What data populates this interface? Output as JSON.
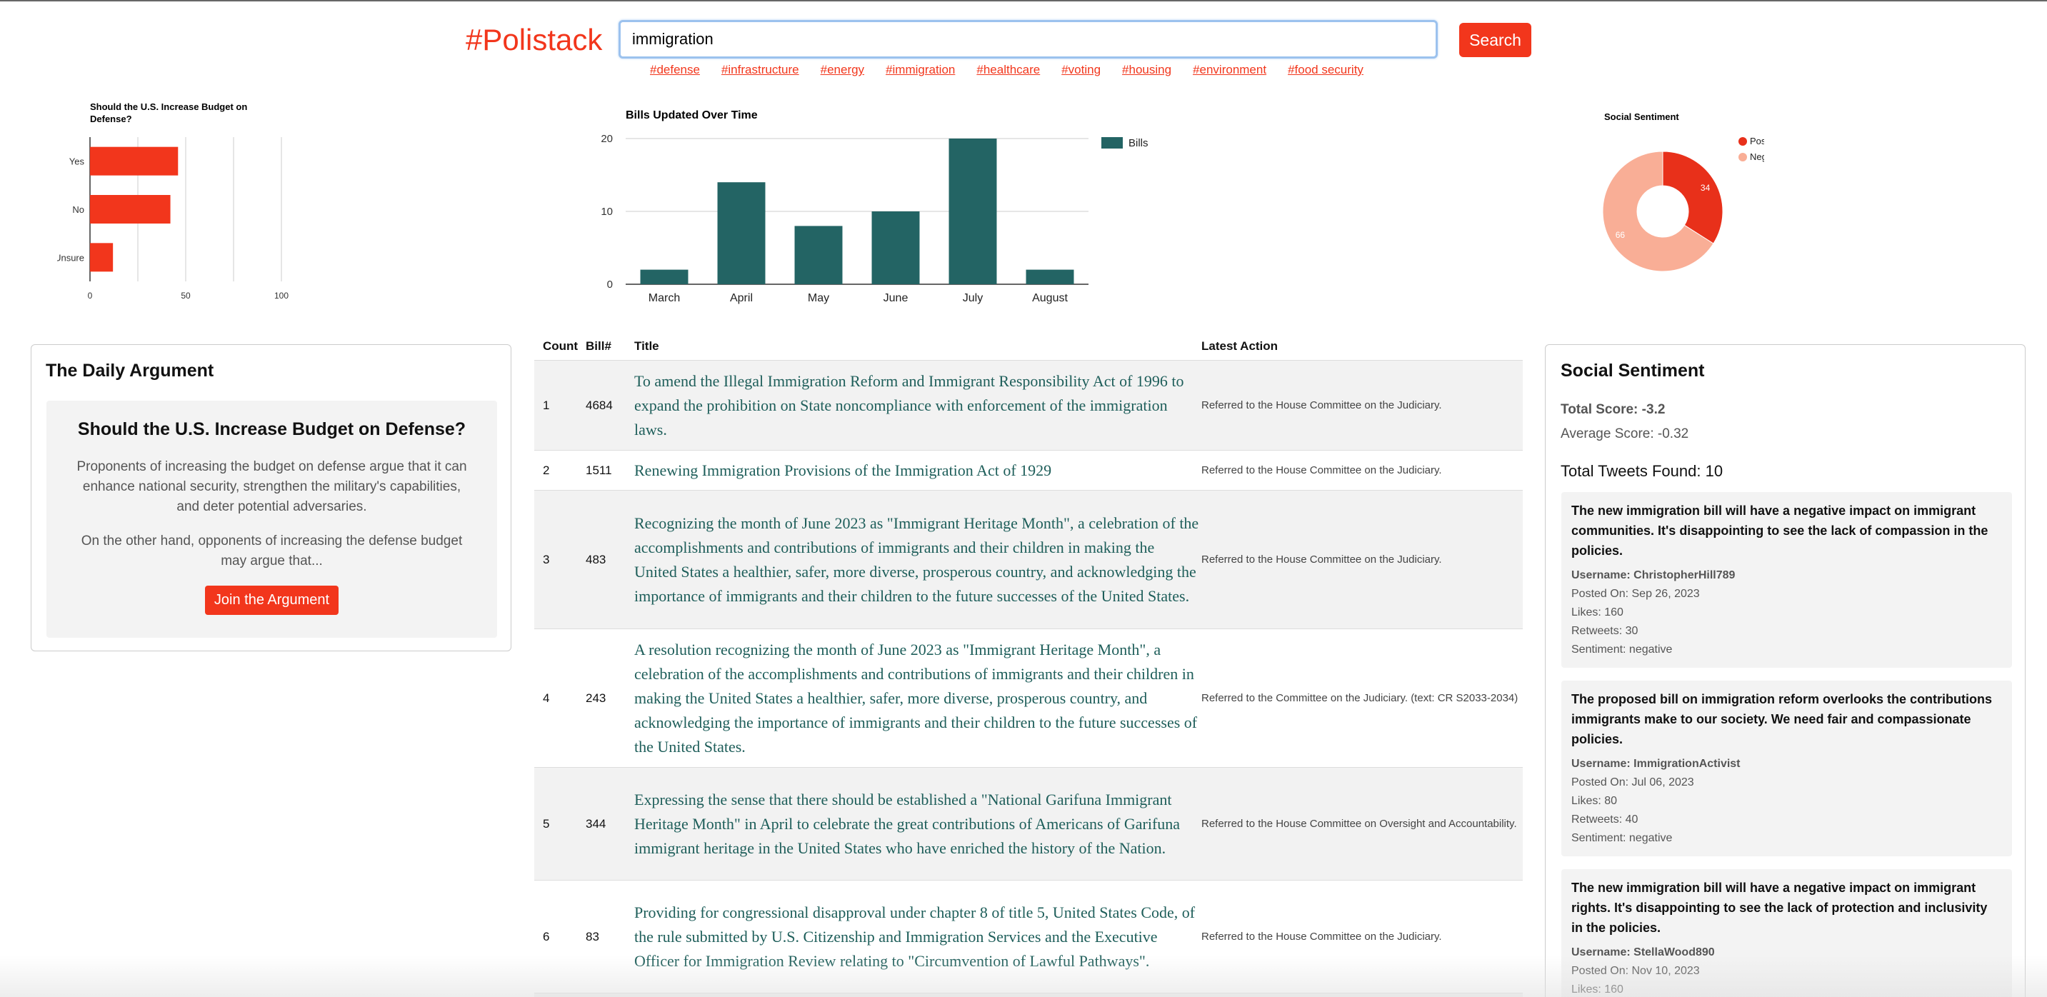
{
  "header": {
    "logo": "#Polistack",
    "search_value": "immigration",
    "search_button": "Search",
    "tags": [
      "#defense",
      "#infrastructure",
      "#energy",
      "#immigration",
      "#healthcare",
      "#voting",
      "#housing",
      "#environment",
      "#food security"
    ]
  },
  "colors": {
    "accent": "#f2361c",
    "bar_teal": "#236464",
    "link_teal": "#1e5e5a",
    "negative_slice": "#f9ae96"
  },
  "poll_chart": {
    "chart_data": {
      "type": "bar",
      "orientation": "horizontal",
      "title": "Should the U.S. Increase Budget on Defense?",
      "categories": [
        "Yes",
        "No",
        "Unsure"
      ],
      "values": [
        46,
        42,
        12
      ],
      "xlim": [
        0,
        100
      ],
      "xticks": [
        "0",
        "50",
        "100"
      ],
      "color": "#f2361c"
    }
  },
  "bills_chart": {
    "chart_data": {
      "type": "bar",
      "title": "Bills Updated Over Time",
      "categories": [
        "March",
        "April",
        "May",
        "June",
        "July",
        "August"
      ],
      "series": [
        {
          "name": "Bills",
          "values": [
            2,
            14,
            8,
            10,
            20,
            2
          ]
        }
      ],
      "ylim": [
        0,
        20
      ],
      "yticks": [
        "0",
        "10",
        "20"
      ],
      "legend": "right",
      "color": "#236464"
    }
  },
  "sentiment_chart": {
    "chart_data": {
      "type": "pie",
      "donut": true,
      "title": "Social Sentiment",
      "labels": [
        "Positive",
        "Negative"
      ],
      "values": [
        34,
        66
      ],
      "slice_labels": [
        "34",
        "66"
      ],
      "colors": [
        "#e8301a",
        "#f9ae96"
      ],
      "legend": "top-right"
    }
  },
  "argument": {
    "title": "The Daily Argument",
    "question": "Should the U.S. Increase Budget on Defense?",
    "p1": "Proponents of increasing the budget on defense argue that it can enhance national security, strengthen the military's capabilities, and deter potential adversaries.",
    "p2": "On the other hand, opponents of increasing the defense budget may argue that...",
    "button": "Join the Argument"
  },
  "bills_table": {
    "headers": [
      "Count",
      "Bill#",
      "Title",
      "Latest Action"
    ],
    "rows": [
      {
        "count": "1",
        "bill": "4684",
        "title": "To amend the Illegal Immigration Reform and Immigrant Responsibility Act of 1996 to expand the prohibition on State noncompliance with enforcement of the immigration laws.",
        "action": "Referred to the House Committee on the Judiciary."
      },
      {
        "count": "2",
        "bill": "1511",
        "title": "Renewing Immigration Provisions of the Immigration Act of 1929",
        "action": "Referred to the House Committee on the Judiciary."
      },
      {
        "count": "3",
        "bill": "483",
        "title": "Recognizing the month of June 2023 as \"Immigrant Heritage Month\", a celebration of the accomplishments and contributions of immigrants and their children in making the United States a healthier, safer, more diverse, prosperous country, and acknowledging the importance of immigrants and their children to the future successes of the United States.",
        "action": "Referred to the House Committee on the Judiciary."
      },
      {
        "count": "4",
        "bill": "243",
        "title": "A resolution recognizing the month of June 2023 as \"Immigrant Heritage Month\", a celebration of the accomplishments and contributions of immigrants and their children in making the United States a healthier, safer, more diverse, prosperous country, and acknowledging the importance of immigrants and their children to the future successes of the United States.",
        "action": "Referred to the Committee on the Judiciary. (text: CR S2033-2034)"
      },
      {
        "count": "5",
        "bill": "344",
        "title": "Expressing the sense that there should be established a \"National Garifuna Immigrant Heritage Month\" in April to celebrate the great contributions of Americans of Garifuna immigrant heritage in the United States who have enriched the history of the Nation.",
        "action": "Referred to the House Committee on Oversight and Accountability."
      },
      {
        "count": "6",
        "bill": "83",
        "title": "Providing for congressional disapproval under chapter 8 of title 5, United States Code, of the rule submitted by U.S. Citizenship and Immigration Services and the Executive Officer for Immigration Review relating to \"Circumvention of Lawful Pathways\".",
        "action": "Referred to the House Committee on the Judiciary."
      }
    ]
  },
  "social": {
    "title": "Social Sentiment",
    "total_score_label": "Total Score:",
    "total_score": "-3.2",
    "average_score_label": "Average Score:",
    "average_score": "-0.32",
    "tweets_found": "Total Tweets Found: 10",
    "tweets": [
      {
        "text": "The new immigration bill will have a negative impact on immigrant communities. It's disappointing to see the lack of compassion in the policies.",
        "username": "Username: ChristopherHill789",
        "posted": "Posted On: Sep 26, 2023",
        "likes": "Likes: 160",
        "retweets": "Retweets: 30",
        "sentiment": "Sentiment: negative"
      },
      {
        "text": "The proposed bill on immigration reform overlooks the contributions immigrants make to our society. We need fair and compassionate policies.",
        "username": "Username: ImmigrationActivist",
        "posted": "Posted On: Jul 06, 2023",
        "likes": "Likes: 80",
        "retweets": "Retweets: 40",
        "sentiment": "Sentiment: negative"
      },
      {
        "text": "The new immigration bill will have a negative impact on immigrant rights. It's disappointing to see the lack of protection and inclusivity in the policies.",
        "username": "Username: StellaWood890",
        "posted": "Posted On: Nov 10, 2023",
        "likes": "Likes: 160",
        "retweets": "",
        "sentiment": ""
      }
    ]
  }
}
